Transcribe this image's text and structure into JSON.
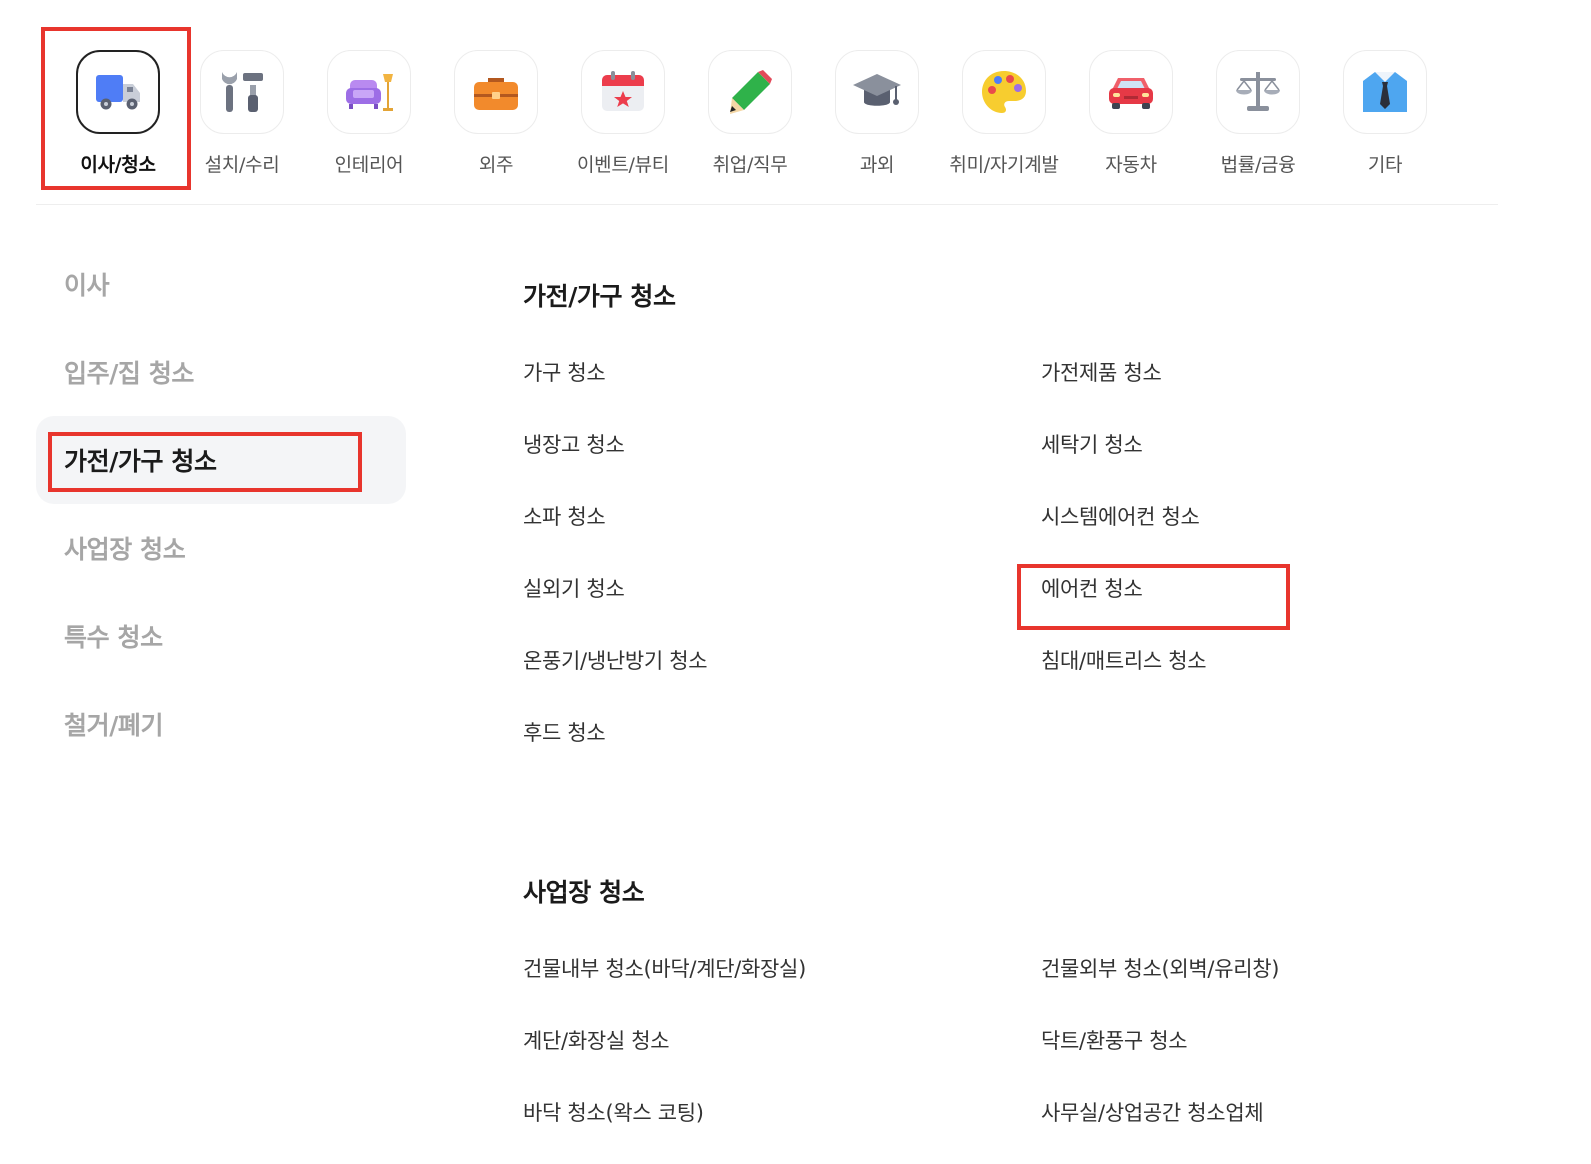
{
  "categories": [
    {
      "label": "이사/청소",
      "icon": "moving-truck-icon",
      "active": true
    },
    {
      "label": "설치/수리",
      "icon": "wrench-screwdriver-icon"
    },
    {
      "label": "인테리어",
      "icon": "sofa-lamp-icon"
    },
    {
      "label": "외주",
      "icon": "briefcase-icon"
    },
    {
      "label": "이벤트/뷰티",
      "icon": "calendar-icon"
    },
    {
      "label": "취업/직무",
      "icon": "pencil-icon"
    },
    {
      "label": "과외",
      "icon": "graduation-cap-icon"
    },
    {
      "label": "취미/자기계발",
      "icon": "palette-icon"
    },
    {
      "label": "자동차",
      "icon": "car-icon"
    },
    {
      "label": "법률/금융",
      "icon": "scale-icon"
    },
    {
      "label": "기타",
      "icon": "shirt-tie-icon"
    }
  ],
  "sidebar": {
    "items": [
      {
        "label": "이사"
      },
      {
        "label": "입주/집 청소"
      },
      {
        "label": "가전/가구 청소",
        "active": true
      },
      {
        "label": "사업장 청소"
      },
      {
        "label": "특수 청소"
      },
      {
        "label": "철거/폐기"
      }
    ]
  },
  "main": {
    "sections": [
      {
        "title": "가전/가구 청소",
        "items": [
          "가구 청소",
          "가전제품 청소",
          "냉장고 청소",
          "세탁기 청소",
          "소파 청소",
          "시스템에어컨 청소",
          "실외기 청소",
          "에어컨 청소",
          "온풍기/냉난방기 청소",
          "침대/매트리스 청소",
          "후드 청소"
        ]
      },
      {
        "title": "사업장 청소",
        "items": [
          "건물내부 청소(바닥/계단/화장실)",
          "건물외부 청소(외벽/유리창)",
          "계단/화장실 청소",
          "닥트/환풍구 청소",
          "바닥 청소(왁스 코팅)",
          "사무실/상업공간 청소업체"
        ]
      }
    ]
  },
  "colors": {
    "highlight": "#e8352d",
    "active_text": "#111111",
    "inactive_sidebar": "#a6a6a6",
    "active_bg": "#f4f5f7"
  }
}
